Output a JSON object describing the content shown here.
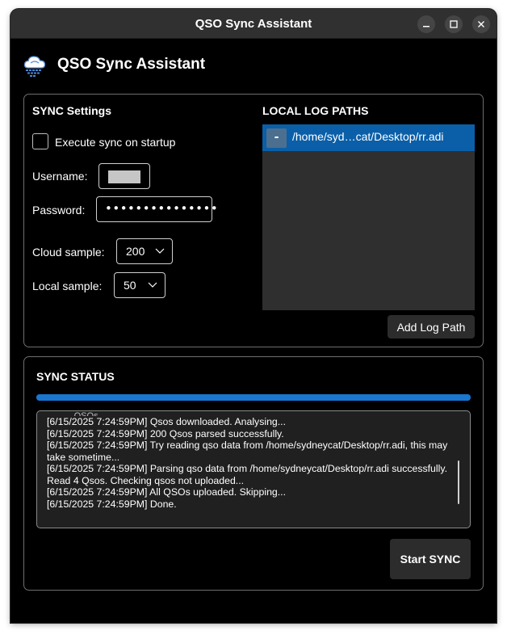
{
  "window": {
    "title": "QSO Sync Assistant"
  },
  "app": {
    "title": "QSO Sync Assistant",
    "logo_icon": "cloud-sync-icon"
  },
  "settings": {
    "heading": "SYNC Settings",
    "execute_on_startup_label": "Execute sync on startup",
    "execute_on_startup_checked": false,
    "username_label": "Username:",
    "username_value": "",
    "password_label": "Password:",
    "password_value": "•••••••••••••••",
    "cloud_sample_label": "Cloud sample:",
    "cloud_sample_value": "200",
    "local_sample_label": "Local sample:",
    "local_sample_value": "50"
  },
  "log_paths": {
    "heading": "LOCAL LOG PATHS",
    "items": [
      {
        "remove_label": "-",
        "path": "/home/syd…cat/Desktop/rr.adi"
      }
    ],
    "add_button": "Add Log Path"
  },
  "status": {
    "heading": "SYNC STATUS",
    "progress_percent": 100,
    "log": [
      "[6/15/2025 7:24:59PM] Qsos downloaded. Analysing...",
      "[6/15/2025 7:24:59PM] 200 Qsos parsed successfully.",
      "[6/15/2025 7:24:59PM] Try reading qso data from /home/sydneycat/Desktop/rr.adi, this may take sometime...",
      "[6/15/2025 7:24:59PM] Parsing qso data from /home/sydneycat/Desktop/rr.adi successfully. Read 4 Qsos. Checking qsos not uploaded...",
      "[6/15/2025 7:24:59PM] All QSOs uploaded. Skipping...",
      "[6/15/2025 7:24:59PM] Done."
    ],
    "start_button": "Start SYNC"
  },
  "colors": {
    "accent": "#1a76cf",
    "selection": "#0a5fa8",
    "background": "#000000",
    "titlebar": "#303030"
  }
}
